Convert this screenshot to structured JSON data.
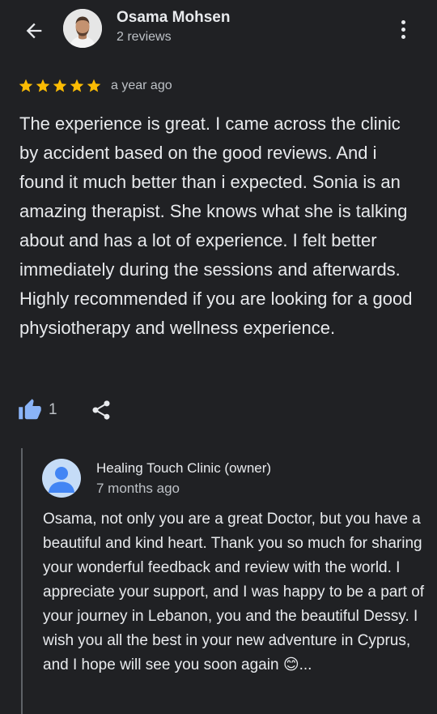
{
  "reviewer": {
    "name": "Osama Mohsen",
    "review_count": "2 reviews"
  },
  "review": {
    "rating": 5,
    "rating_max": 5,
    "date": "a year ago",
    "text": "The experience is great. I came across the clinic by accident based on the good reviews. And i found it much better than i expected. Sonia is an amazing therapist. She knows what she is talking about and has a lot of experience. I felt better immediately during the sessions and afterwards. Highly recommended if you are looking for a good physiotherapy and wellness experience.",
    "like_count": "1"
  },
  "owner_reply": {
    "name": "Healing Touch Clinic (owner)",
    "date": "7 months ago",
    "text": "Osama, not only you are a great Doctor, but you have a beautiful and kind heart. Thank you so much for sharing your wonderful feedback and review with the world. I appreciate your support, and I was happy to be a part of your journey in Lebanon, you and the beautiful Dessy. I wish you all the best in your new adventure in Cyprus, and I hope will see you soon again 😊..."
  },
  "icons": {
    "back": "arrow-back-icon",
    "more": "more-vert-icon",
    "star": "star-icon",
    "like": "thumb-up-icon",
    "share": "share-icon",
    "owner_avatar": "person-icon"
  },
  "colors": {
    "background": "#202124",
    "star": "#fbbc04",
    "like": "#8ab4f8",
    "owner_avatar_bg": "#c5dcf7",
    "owner_avatar_fg": "#4285f4"
  }
}
